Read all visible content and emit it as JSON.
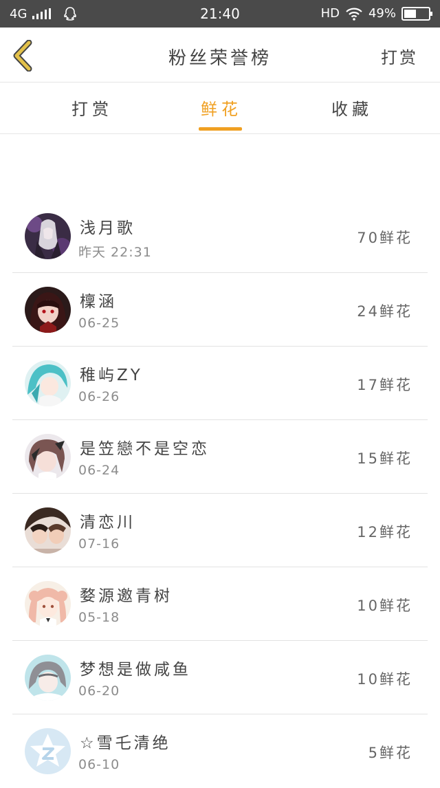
{
  "status_bar": {
    "network": "4G",
    "time": "21:40",
    "hd": "HD",
    "battery": "49%",
    "battery_level": 0.49
  },
  "header": {
    "title": "粉丝荣誉榜",
    "action_label": "打赏"
  },
  "tabs": [
    {
      "label": "打赏",
      "active": false
    },
    {
      "label": "鲜花",
      "active": true
    },
    {
      "label": "收藏",
      "active": false
    }
  ],
  "colors": {
    "accent": "#f0a022",
    "status_bar_bg": "#4a4a4a",
    "back_icon": "#d4a017"
  },
  "fans": [
    {
      "name": "浅月歌",
      "date": "昨天 22:31",
      "count": "70鲜花",
      "avatar": "avatar-dark-purple"
    },
    {
      "name": "檁涵",
      "date": "06-25",
      "count": "24鲜花",
      "avatar": "avatar-red-dark"
    },
    {
      "name": "稚屿ZY",
      "date": "06-26",
      "count": "17鲜花",
      "avatar": "avatar-teal-hair"
    },
    {
      "name": "是笠戀不是空恋",
      "date": "06-24",
      "count": "15鲜花",
      "avatar": "avatar-brown-girl"
    },
    {
      "name": "清恋川",
      "date": "07-16",
      "count": "12鲜花",
      "avatar": "avatar-dark-couple"
    },
    {
      "name": "婺源邀青树",
      "date": "05-18",
      "count": "10鲜花",
      "avatar": "avatar-pink-girl"
    },
    {
      "name": "梦想是做咸鱼",
      "date": "06-20",
      "count": "10鲜花",
      "avatar": "avatar-grey-girl"
    },
    {
      "name": "☆雪乇清绝",
      "date": "06-10",
      "count": "5鲜花",
      "avatar": "avatar-default-star"
    }
  ]
}
